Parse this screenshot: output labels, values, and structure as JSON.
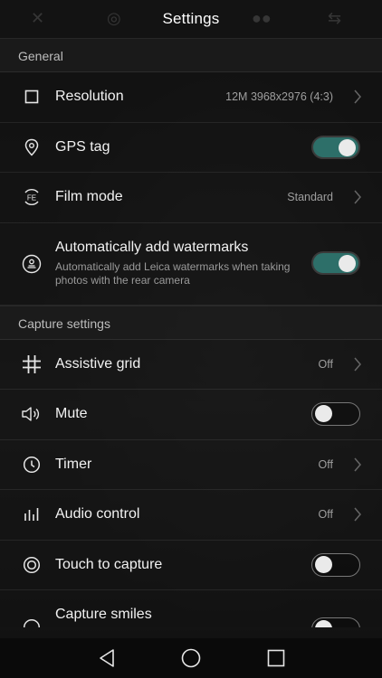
{
  "header": {
    "title": "Settings"
  },
  "sections": {
    "general": {
      "title": "General",
      "resolution": {
        "label": "Resolution",
        "value": "12M 3968x2976 (4:3)",
        "icon": "square-icon"
      },
      "gps_tag": {
        "label": "GPS tag",
        "state": "on",
        "icon": "location-pin-icon"
      },
      "film_mode": {
        "label": "Film mode",
        "value": "Standard",
        "icon": "film-fe-icon"
      },
      "watermarks": {
        "label": "Automatically add watermarks",
        "description": "Automatically add Leica watermarks when taking photos with the rear camera",
        "state": "on",
        "icon": "watermark-stamp-icon"
      }
    },
    "capture": {
      "title": "Capture settings",
      "assistive_grid": {
        "label": "Assistive grid",
        "value": "Off",
        "icon": "grid-icon"
      },
      "mute": {
        "label": "Mute",
        "state": "off",
        "icon": "speaker-icon"
      },
      "timer": {
        "label": "Timer",
        "value": "Off",
        "icon": "clock-icon"
      },
      "audio_control": {
        "label": "Audio control",
        "value": "Off",
        "icon": "audio-bars-icon"
      },
      "touch_to_capture": {
        "label": "Touch to capture",
        "state": "off",
        "icon": "target-icon"
      },
      "capture_smiles": {
        "label": "Capture smiles",
        "state": "off",
        "icon": "smile-icon"
      }
    }
  },
  "colors": {
    "toggle_on": "#2d6f69",
    "background": "#0d0d0d"
  },
  "navbar": {
    "back": "back-triangle-icon",
    "home": "home-circle-icon",
    "recents": "recents-square-icon"
  }
}
